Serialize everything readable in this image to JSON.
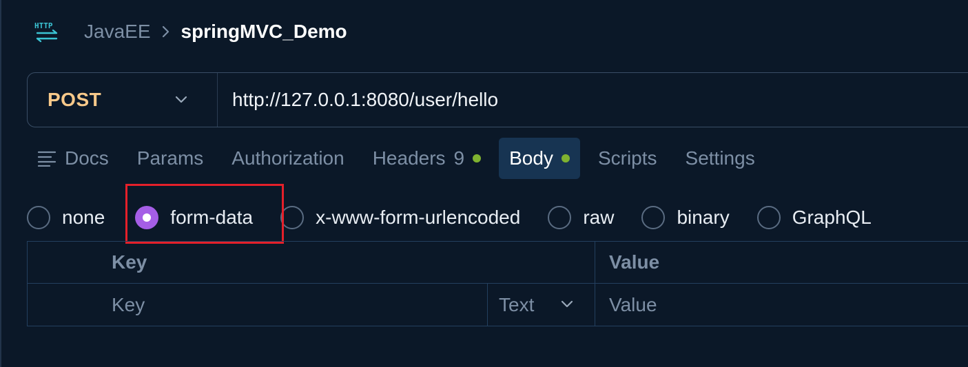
{
  "breadcrumb": {
    "icon": "http-icon",
    "parent": "JavaEE",
    "separator": "chevron-right-icon",
    "current": "springMVC_Demo"
  },
  "request": {
    "method": "POST",
    "url": "http://127.0.0.1:8080/user/hello"
  },
  "tabs": [
    {
      "label": "Docs",
      "icon": "docs-icon"
    },
    {
      "label": "Params"
    },
    {
      "label": "Authorization"
    },
    {
      "label": "Headers",
      "count": "9",
      "dot": true
    },
    {
      "label": "Body",
      "active": true,
      "dot": true
    },
    {
      "label": "Scripts"
    },
    {
      "label": "Settings"
    }
  ],
  "body_types": {
    "options": [
      "none",
      "form-data",
      "x-www-form-urlencoded",
      "raw",
      "binary",
      "GraphQL"
    ],
    "selected": "form-data"
  },
  "form_table": {
    "headers": {
      "key": "Key",
      "value": "Value"
    },
    "row": {
      "key_placeholder": "Key",
      "type": "Text",
      "value_placeholder": "Value"
    }
  },
  "colors": {
    "background": "#0b1828",
    "method": "#f8c98a",
    "radio_selected": "#a55ee6",
    "status_dot": "#7fb230",
    "highlight": "#e5202a"
  }
}
